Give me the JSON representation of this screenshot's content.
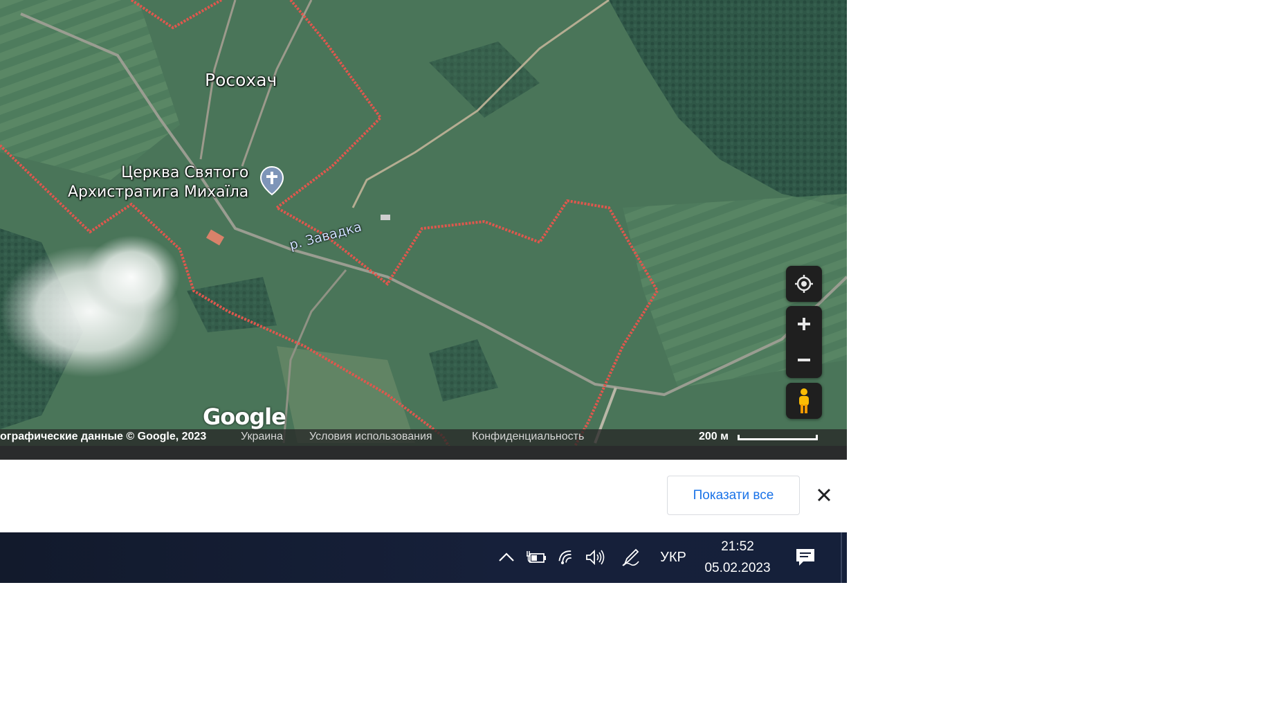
{
  "map": {
    "labels": {
      "village": "Росохач",
      "church_line1": "Церква Святого",
      "church_line2": "Архистратига Михаїла",
      "river": "р. Завадка"
    },
    "logo": "Google",
    "attribution": {
      "data": "ографические данные © Google, 2023",
      "country": "Украина",
      "terms": "Условия использования",
      "privacy": "Конфиденциальность",
      "scale": "200 м"
    },
    "controls": {
      "locate": "my-location-icon",
      "zoom_in": "plus-icon",
      "zoom_out": "minus-icon",
      "street_view": "pegman-icon"
    }
  },
  "download_bar": {
    "show_all_label": "Показати все",
    "close_icon": "close-icon"
  },
  "taskbar": {
    "language": "УКР",
    "time": "21:52",
    "date": "05.02.2023",
    "tray_icons": [
      "chevron-up-icon",
      "battery-charging-icon",
      "wifi-icon",
      "volume-icon",
      "pen-icon",
      "notification-icon"
    ]
  },
  "colors": {
    "boundary": "#e0574d",
    "link_blue": "#1a73e8",
    "taskbar": "#16203a"
  }
}
